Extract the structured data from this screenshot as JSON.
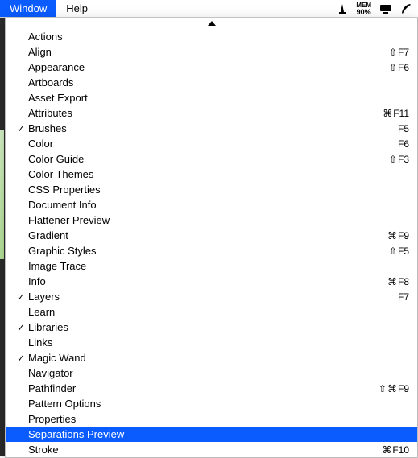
{
  "menubar": {
    "window_label": "Window",
    "help_label": "Help",
    "mem_label": "MEM",
    "mem_value": "90%"
  },
  "dropdown": {
    "items": [
      {
        "label": "Actions",
        "checked": false,
        "shortcut": null,
        "highlighted": false
      },
      {
        "label": "Align",
        "checked": false,
        "shortcut": {
          "mods": [
            "⇧"
          ],
          "key": "F7"
        },
        "highlighted": false
      },
      {
        "label": "Appearance",
        "checked": false,
        "shortcut": {
          "mods": [
            "⇧"
          ],
          "key": "F6"
        },
        "highlighted": false
      },
      {
        "label": "Artboards",
        "checked": false,
        "shortcut": null,
        "highlighted": false
      },
      {
        "label": "Asset Export",
        "checked": false,
        "shortcut": null,
        "highlighted": false
      },
      {
        "label": "Attributes",
        "checked": false,
        "shortcut": {
          "mods": [
            "⌘"
          ],
          "key": "F11"
        },
        "highlighted": false
      },
      {
        "label": "Brushes",
        "checked": true,
        "shortcut": {
          "mods": [],
          "key": "F5"
        },
        "highlighted": false
      },
      {
        "label": "Color",
        "checked": false,
        "shortcut": {
          "mods": [],
          "key": "F6"
        },
        "highlighted": false
      },
      {
        "label": "Color Guide",
        "checked": false,
        "shortcut": {
          "mods": [
            "⇧"
          ],
          "key": "F3"
        },
        "highlighted": false
      },
      {
        "label": "Color Themes",
        "checked": false,
        "shortcut": null,
        "highlighted": false
      },
      {
        "label": "CSS Properties",
        "checked": false,
        "shortcut": null,
        "highlighted": false
      },
      {
        "label": "Document Info",
        "checked": false,
        "shortcut": null,
        "highlighted": false
      },
      {
        "label": "Flattener Preview",
        "checked": false,
        "shortcut": null,
        "highlighted": false
      },
      {
        "label": "Gradient",
        "checked": false,
        "shortcut": {
          "mods": [
            "⌘"
          ],
          "key": "F9"
        },
        "highlighted": false
      },
      {
        "label": "Graphic Styles",
        "checked": false,
        "shortcut": {
          "mods": [
            "⇧"
          ],
          "key": "F5"
        },
        "highlighted": false
      },
      {
        "label": "Image Trace",
        "checked": false,
        "shortcut": null,
        "highlighted": false
      },
      {
        "label": "Info",
        "checked": false,
        "shortcut": {
          "mods": [
            "⌘"
          ],
          "key": "F8"
        },
        "highlighted": false
      },
      {
        "label": "Layers",
        "checked": true,
        "shortcut": {
          "mods": [],
          "key": "F7"
        },
        "highlighted": false
      },
      {
        "label": "Learn",
        "checked": false,
        "shortcut": null,
        "highlighted": false
      },
      {
        "label": "Libraries",
        "checked": true,
        "shortcut": null,
        "highlighted": false
      },
      {
        "label": "Links",
        "checked": false,
        "shortcut": null,
        "highlighted": false
      },
      {
        "label": "Magic Wand",
        "checked": true,
        "shortcut": null,
        "highlighted": false
      },
      {
        "label": "Navigator",
        "checked": false,
        "shortcut": null,
        "highlighted": false
      },
      {
        "label": "Pathfinder",
        "checked": false,
        "shortcut": {
          "mods": [
            "⇧",
            "⌘"
          ],
          "key": "F9"
        },
        "highlighted": false
      },
      {
        "label": "Pattern Options",
        "checked": false,
        "shortcut": null,
        "highlighted": false
      },
      {
        "label": "Properties",
        "checked": false,
        "shortcut": null,
        "highlighted": false
      },
      {
        "label": "Separations Preview",
        "checked": false,
        "shortcut": null,
        "highlighted": true
      },
      {
        "label": "Stroke",
        "checked": false,
        "shortcut": {
          "mods": [
            "⌘"
          ],
          "key": "F10"
        },
        "highlighted": false
      }
    ]
  }
}
